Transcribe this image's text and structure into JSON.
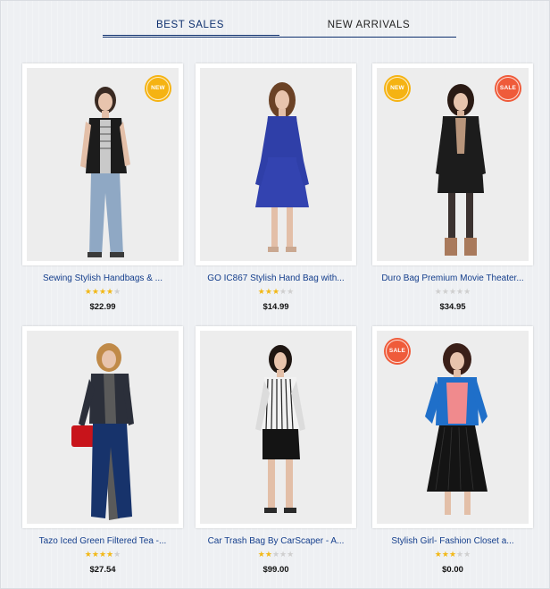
{
  "tabs": {
    "best_sales": "BEST SALES",
    "new_arrivals": "NEW ARRIVALS"
  },
  "badges": {
    "new": "NEW",
    "sale": "SALE"
  },
  "colors": {
    "accent_navy": "#0d2f6e",
    "title_blue": "#143e8c",
    "badge_new": "#f5b313",
    "badge_sale": "#ef5b3a",
    "star_on": "#f2b817",
    "star_off": "#cfcfcf"
  },
  "products": [
    {
      "title": "Sewing Stylish Handbags & ...",
      "rating": 4,
      "price": "$22.99",
      "badges": [
        "NEW"
      ]
    },
    {
      "title": "GO IC867 Stylish Hand Bag with...",
      "rating": 2.5,
      "price": "$14.99",
      "badges": []
    },
    {
      "title": "Duro Bag Premium Movie Theater...",
      "rating": 0,
      "price": "$34.95",
      "badges": [
        "NEW",
        "SALE"
      ]
    },
    {
      "title": "Tazo Iced Green Filtered Tea -...",
      "rating": 3.5,
      "price": "$27.54",
      "badges": []
    },
    {
      "title": "Car Trash Bag By CarScaper - A...",
      "rating": 1.5,
      "price": "$99.00",
      "badges": []
    },
    {
      "title": "Stylish Girl- Fashion Closet a...",
      "rating": 2.5,
      "price": "$0.00",
      "badges": [
        "SALE"
      ]
    }
  ]
}
